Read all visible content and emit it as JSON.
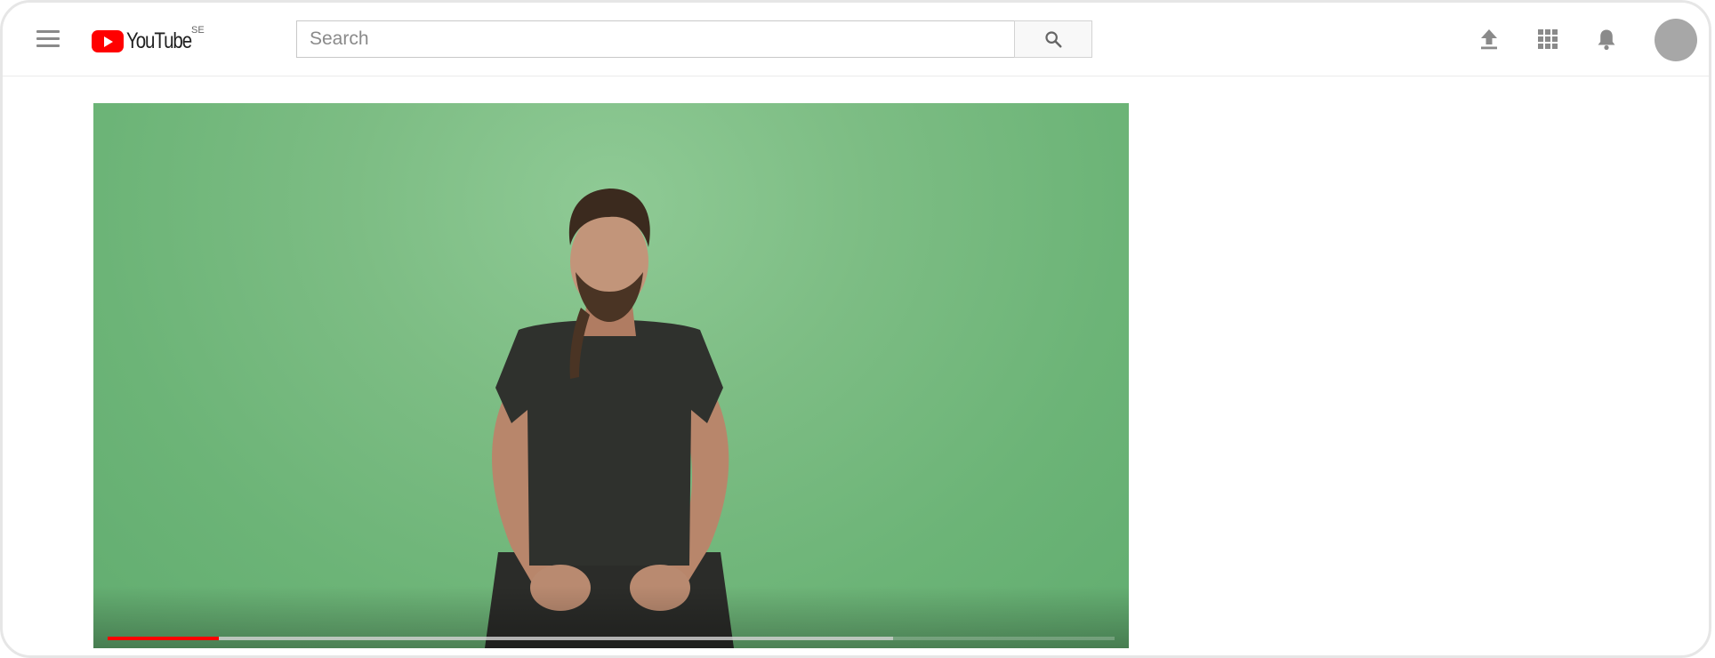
{
  "app": {
    "name": "YouTube",
    "country_code": "SE"
  },
  "search": {
    "placeholder": "Search",
    "value": ""
  },
  "icons": {
    "menu": "hamburger-menu-icon",
    "search": "magnifier-search-icon",
    "upload": "upload-arrow-icon",
    "apps": "apps-grid-icon",
    "notifications": "bell-icon",
    "avatar": "user-avatar"
  },
  "player": {
    "progress_played_fraction": 0.11,
    "progress_buffered_fraction": 0.78
  },
  "colors": {
    "brand_red": "#ff0000",
    "icon_gray": "#8a8a8a",
    "video_background": "#7dbd84"
  }
}
